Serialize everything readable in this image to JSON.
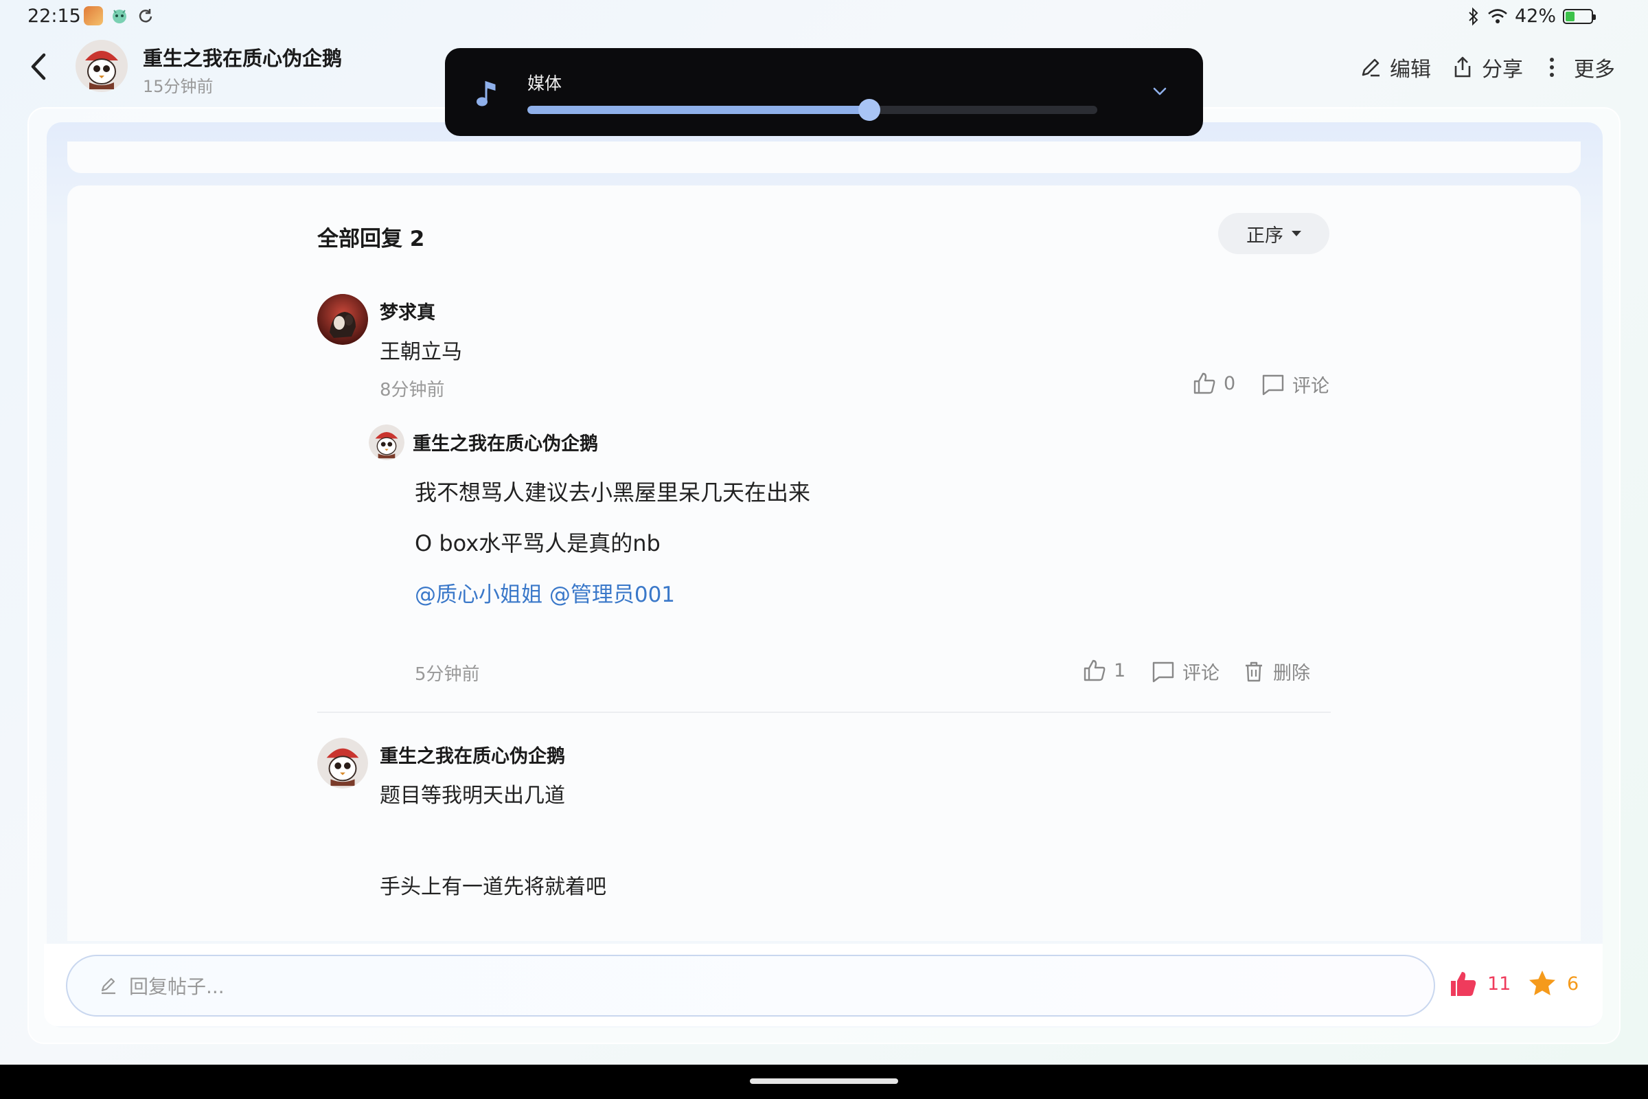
{
  "status_bar": {
    "time": "22:15",
    "battery": "42%",
    "battery_level": 0.42
  },
  "header": {
    "title": "重生之我在质心伪企鹅",
    "time": "15分钟前",
    "actions": {
      "edit": "编辑",
      "share": "分享",
      "more": "更多"
    }
  },
  "media_popup": {
    "label": "媒体",
    "level": 0.6
  },
  "replies": {
    "title": "全部回复 2",
    "sort_label": "正序",
    "items": [
      {
        "username": "梦求真",
        "text": "王朝立马",
        "time": "8分钟前",
        "likes": "0",
        "comment_label": "评论",
        "sub_reply": {
          "username": "重生之我在质心伪企鹅",
          "lines": [
            "我不想骂人建议去小黑屋里呆几天在出来",
            "O box水平骂人是真的nb"
          ],
          "mentions": "@质心小姐姐 @管理员001",
          "time": "5分钟前",
          "likes": "1",
          "comment_label": "评论",
          "delete_label": "删除"
        }
      },
      {
        "username": "重生之我在质心伪企鹅",
        "lines": [
          "题目等我明天出几道",
          "手头上有一道先将就着吧"
        ]
      }
    ]
  },
  "bottom": {
    "reply_placeholder": "回复帖子...",
    "likes": "11",
    "favorites": "6",
    "colors": {
      "like": "#ef3b5c",
      "favorite": "#f59a1b"
    }
  }
}
